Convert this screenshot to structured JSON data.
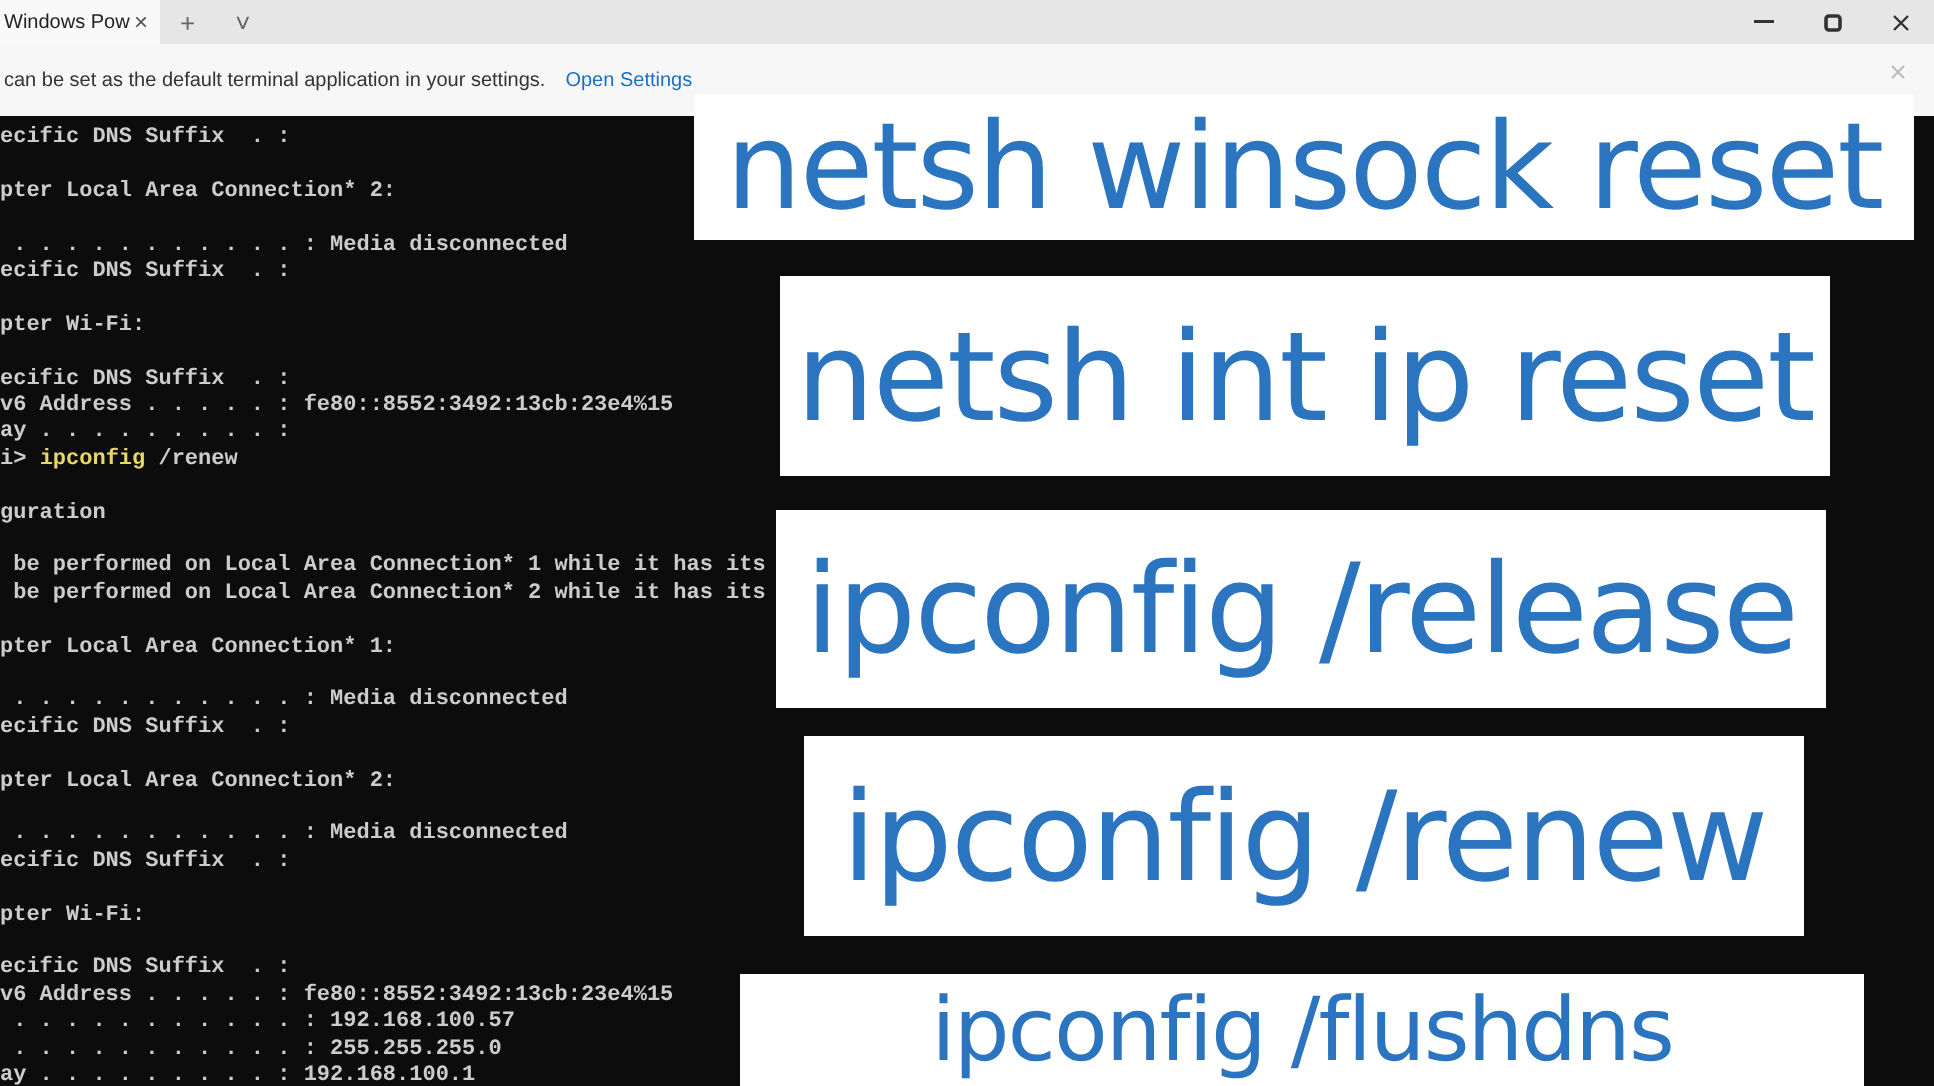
{
  "window": {
    "tab_title": "Windows Pow",
    "tab_close": "×",
    "new_tab": "+",
    "tab_menu": "˅"
  },
  "info_bar": {
    "message": "can be set as the default terminal application in your settings.",
    "link": "Open Settings"
  },
  "terminal": {
    "blocks": [
      [
        {
          "kind": "output",
          "text": "ecific DNS Suffix  . :"
        }
      ],
      [
        {
          "kind": "output",
          "text": "pter Local Area Connection* 2:"
        }
      ],
      [
        {
          "kind": "output",
          "text": " . . . . . . . . . . . : Media disconnected"
        },
        {
          "kind": "output",
          "text": "ecific DNS Suffix  . :"
        }
      ],
      [
        {
          "kind": "output",
          "text": "pter Wi-Fi:"
        }
      ],
      [
        {
          "kind": "output",
          "text": "ecific DNS Suffix  . :"
        },
        {
          "kind": "output",
          "text": "v6 Address . . . . . : fe80::8552:3492:13cb:23e4%15"
        },
        {
          "kind": "output",
          "text": "ay . . . . . . . . . :"
        },
        {
          "kind": "command",
          "prompt": "i>",
          "command": "ipconfig",
          "args": "/renew"
        }
      ],
      [
        {
          "kind": "output",
          "text": "guration"
        }
      ],
      [
        {
          "kind": "output",
          "text": " be performed on Local Area Connection* 1 while it has its"
        },
        {
          "kind": "output",
          "text": " be performed on Local Area Connection* 2 while it has its"
        }
      ],
      [
        {
          "kind": "output",
          "text": "pter Local Area Connection* 1:"
        }
      ],
      [
        {
          "kind": "output",
          "text": " . . . . . . . . . . . : Media disconnected"
        },
        {
          "kind": "output",
          "text": "ecific DNS Suffix  . :"
        }
      ],
      [
        {
          "kind": "output",
          "text": "pter Local Area Connection* 2:"
        }
      ],
      [
        {
          "kind": "output",
          "text": " . . . . . . . . . . . : Media disconnected"
        },
        {
          "kind": "output",
          "text": "ecific DNS Suffix  . :"
        }
      ],
      [
        {
          "kind": "output",
          "text": "pter Wi-Fi:"
        }
      ],
      [
        {
          "kind": "output",
          "text": "ecific DNS Suffix  . :"
        },
        {
          "kind": "output",
          "text": "v6 Address . . . . . : fe80::8552:3492:13cb:23e4%15"
        },
        {
          "kind": "output",
          "text": " . . . . . . . . . . . : 192.168.100.57"
        },
        {
          "kind": "output",
          "text": " . . . . . . . . . . . : 255.255.255.0"
        },
        {
          "kind": "output",
          "text": "ay . . . . . . . . . : 192.168.100.1"
        }
      ]
    ]
  },
  "captions": [
    "netsh winsock reset",
    "netsh int ip reset",
    "ipconfig /release",
    "ipconfig /renew",
    "ipconfig /flushdns"
  ]
}
